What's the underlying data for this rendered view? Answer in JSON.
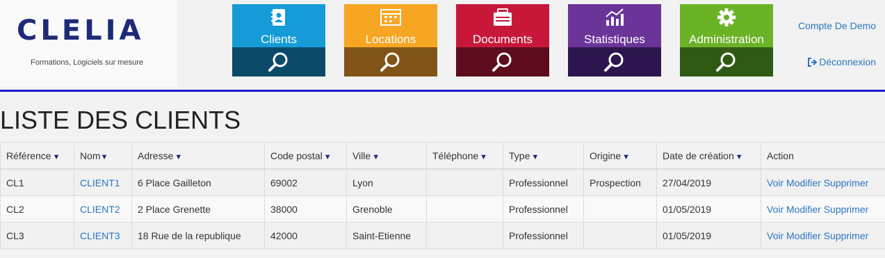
{
  "brand": {
    "name": "CLELIA",
    "tagline": "Formations, Logiciels sur mesure",
    "color": "#1e2a78"
  },
  "nav": {
    "tiles": [
      {
        "label": "Clients",
        "icon": "address-book-icon",
        "top_color": "#159bd7",
        "bottom_color": "#0c4a6a"
      },
      {
        "label": "Locations",
        "icon": "calendar-icon",
        "top_color": "#f6a623",
        "bottom_color": "#7f5416"
      },
      {
        "label": "Documents",
        "icon": "folder-icon",
        "top_color": "#c8183a",
        "bottom_color": "#5c0c1c"
      },
      {
        "label": "Statistiques",
        "icon": "chart-icon",
        "top_color": "#6a3498",
        "bottom_color": "#2d1650"
      },
      {
        "label": "Administration",
        "icon": "gear-icon",
        "top_color": "#6ab226",
        "bottom_color": "#2f5a14"
      }
    ]
  },
  "user": {
    "account": "Compte De Demo",
    "logout": "Déconnexion"
  },
  "page": {
    "title": "LISTE DES CLIENTS"
  },
  "table": {
    "headers": [
      "Référence",
      "Nom",
      "Adresse",
      "Code postal",
      "Ville",
      "Téléphone",
      "Type",
      "Origine",
      "Date de création",
      "Action"
    ],
    "sort_marker": "▼",
    "rows": [
      {
        "ref": "CL1",
        "nom": "CLIENT1",
        "adresse": "6 Place Gailleton",
        "cp": "69002",
        "ville": "Lyon",
        "tel": "",
        "type": "Professionnel",
        "origine": "Prospection",
        "date": "27/04/2019"
      },
      {
        "ref": "CL2",
        "nom": "CLIENT2",
        "adresse": "2 Place Grenette",
        "cp": "38000",
        "ville": "Grenoble",
        "tel": "",
        "type": "Professionnel",
        "origine": "",
        "date": "01/05/2019"
      },
      {
        "ref": "CL3",
        "nom": "CLIENT3",
        "adresse": "18 Rue de la republique",
        "cp": "42000",
        "ville": "Saint-Etienne",
        "tel": "",
        "type": "Professionnel",
        "origine": "",
        "date": "01/05/2019"
      }
    ],
    "actions": {
      "view": "Voir",
      "edit": "Modifier",
      "delete": "Supprimer"
    }
  }
}
